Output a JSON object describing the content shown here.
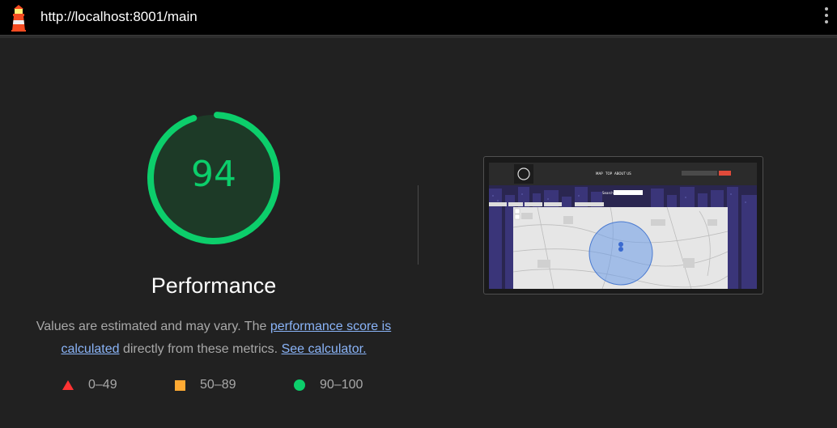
{
  "browser": {
    "url": "http://localhost:8001/main",
    "logo_icon": "lighthouse-icon",
    "menu_icon": "kebab-menu-icon"
  },
  "score": {
    "value": "94",
    "fraction": 0.94,
    "label": "Performance",
    "color": "#0cce6b"
  },
  "description": {
    "prefix": "Values are estimated and may vary. The ",
    "link1": "performance score is calculated",
    "middle": " directly from these metrics. ",
    "link2": "See calculator."
  },
  "legend": [
    {
      "range": "0–49",
      "shape": "triangle",
      "color": "#ff3333"
    },
    {
      "range": "50–89",
      "shape": "square",
      "color": "#ffaa33"
    },
    {
      "range": "90–100",
      "shape": "circle",
      "color": "#0cce6b"
    }
  ],
  "screenshot": {
    "nav_items": [
      "MAP",
      "TOP",
      "ABOUT US"
    ],
    "search_placeholder": "Search",
    "login_label": "LOGIN"
  }
}
